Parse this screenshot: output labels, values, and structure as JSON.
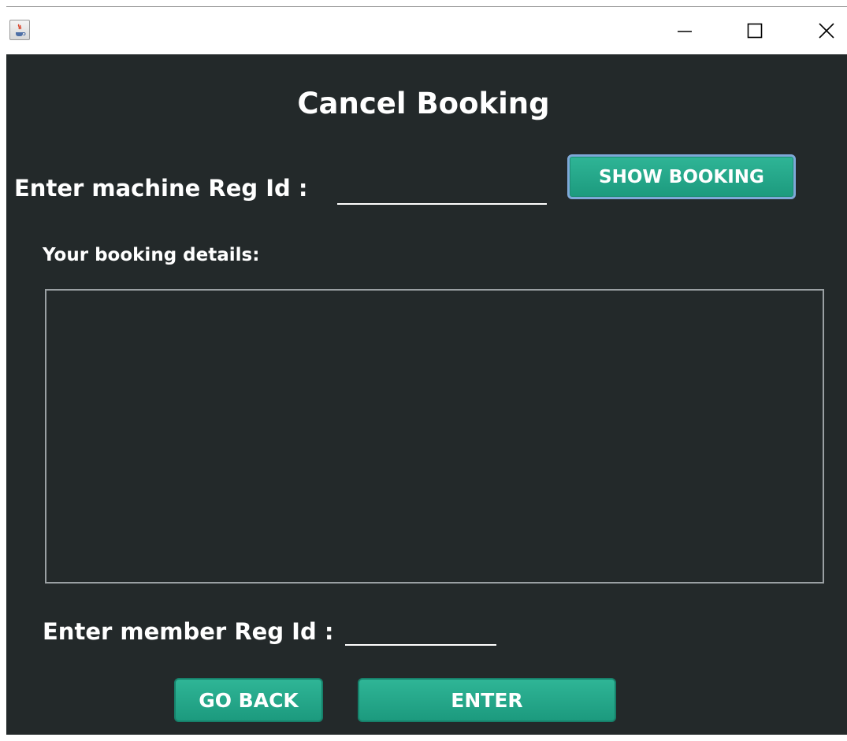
{
  "window": {
    "app_icon": "java-coffee-icon",
    "controls": {
      "minimize_icon": "minimize-icon",
      "maximize_icon": "maximize-icon",
      "close_icon": "close-icon"
    }
  },
  "form": {
    "title": "Cancel Booking",
    "machine_label": "Enter machine Reg Id :",
    "machine_value": "",
    "show_booking_label": "SHOW BOOKING",
    "details_label": "Your booking details:",
    "details_value": "",
    "member_label": "Enter member Reg Id :",
    "member_value": "",
    "go_back_label": "GO BACK",
    "enter_label": "ENTER"
  },
  "colors": {
    "panel_bg": "#23292a",
    "button_teal": "#22a587",
    "text": "#ffffff",
    "focus_border": "#7ea8d8"
  }
}
